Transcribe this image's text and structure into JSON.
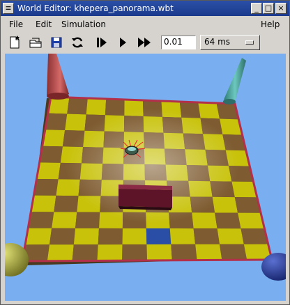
{
  "window": {
    "title": "World Editor: khepera_panorama.wbt"
  },
  "title_buttons": {
    "minimize": "_",
    "maximize": "□",
    "close": "×"
  },
  "menu": {
    "file": "File",
    "edit": "Edit",
    "simulation": "Simulation",
    "help": "Help"
  },
  "toolbar": {
    "icons": [
      "new-world-icon",
      "open-world-icon",
      "save-world-icon",
      "revert-icon",
      "step-icon",
      "run-icon",
      "fast-icon"
    ],
    "step_value": "0.01",
    "speed_value": "64 ms"
  },
  "scene": {
    "sky_color": "#79aef0",
    "tile_yellow": "#c8c20a",
    "tile_brown": "#7e5b30",
    "marked_tile_color": "#2a4ea5",
    "wall_color": "#b2304a",
    "obstacle_color": "#6b1a30",
    "cone_colors": [
      "#b7494b",
      "#4aa59e",
      "#c8c84f",
      "#233a9c"
    ]
  }
}
